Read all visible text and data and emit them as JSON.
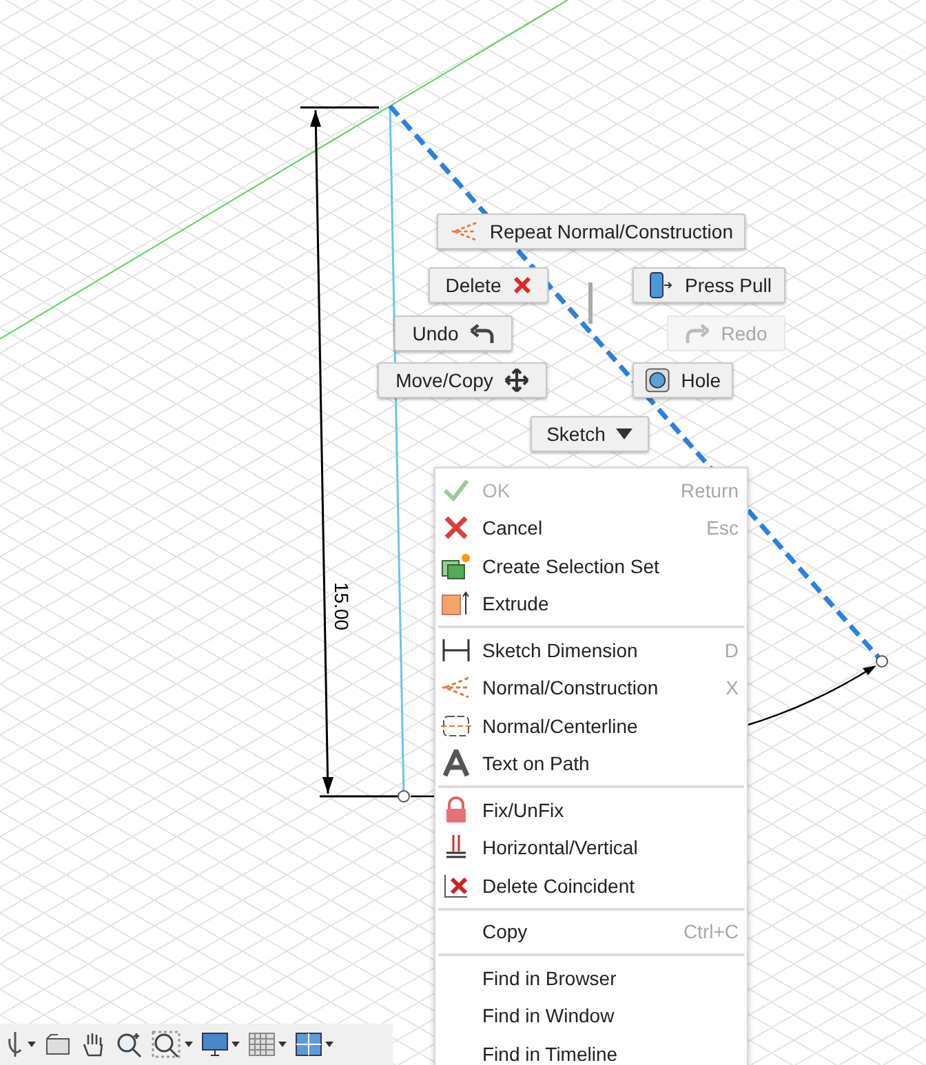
{
  "dimension": {
    "value": "15.00"
  },
  "marking_menu": [
    {
      "label": "Repeat Normal/Construction",
      "disabled": false
    },
    {
      "label": "Delete",
      "disabled": false
    },
    {
      "label": "Press Pull",
      "disabled": false
    },
    {
      "label": "Undo",
      "disabled": false
    },
    {
      "label": "Redo",
      "disabled": true
    },
    {
      "label": "Move/Copy",
      "disabled": false
    },
    {
      "label": "Hole",
      "disabled": false
    },
    {
      "label": "Sketch",
      "disabled": false
    }
  ],
  "context_menu": [
    [
      {
        "label": "OK",
        "shortcut": "Return",
        "disabled": true
      },
      {
        "label": "Cancel",
        "shortcut": "Esc",
        "disabled": false
      },
      {
        "label": "Create Selection Set",
        "disabled": false
      },
      {
        "label": "Extrude",
        "disabled": false
      }
    ],
    [
      {
        "label": "Sketch Dimension",
        "shortcut": "D",
        "disabled": false
      },
      {
        "label": "Normal/Construction",
        "shortcut": "X",
        "disabled": false
      },
      {
        "label": "Normal/Centerline",
        "disabled": false
      },
      {
        "label": "Text on Path",
        "disabled": false
      }
    ],
    [
      {
        "label": "Fix/UnFix",
        "disabled": false
      },
      {
        "label": "Horizontal/Vertical",
        "disabled": false
      },
      {
        "label": "Delete Coincident",
        "disabled": false
      }
    ],
    [
      {
        "label": "Copy",
        "shortcut": "Ctrl+C",
        "disabled": false
      }
    ],
    [
      {
        "label": "Find in Browser",
        "disabled": false
      },
      {
        "label": "Find in Window",
        "disabled": false
      },
      {
        "label": "Find in Timeline",
        "disabled": false
      }
    ]
  ]
}
